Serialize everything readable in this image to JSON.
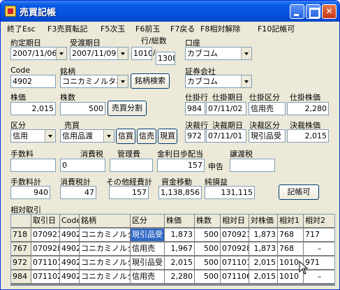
{
  "window": {
    "title": "売買記帳"
  },
  "menu": [
    "終了Esc",
    "F3売買転記",
    "F5次玉",
    "F6前玉",
    "F7戻る",
    "F8相対解除",
    "F10記帳可"
  ],
  "labels": {
    "yakujo_date": "約定期日",
    "ukewatashi_date": "受渡期日",
    "gyo_sosu": "行/総数",
    "koza": "口座",
    "code": "Code",
    "meigara": "銘柄",
    "shoken_gaisha": "証券会社",
    "kabuka": "株価",
    "kabusu": "株数",
    "shikake_gyo": "仕掛行",
    "shikake_kijitsu": "仕掛期日",
    "shikake_kubun": "仕掛区分",
    "shikake_kabuka": "仕掛株価",
    "kubun": "区分",
    "baibai": "売買",
    "kessai_gyo": "決裁行",
    "kessai_kijitsu": "決裁期日",
    "kessai_kubun": "決裁区分",
    "kessai_kabuka": "決裁株価",
    "tesuryo": "手数料",
    "shohizei": "消費税",
    "kanrihi": "管理費",
    "kinri": "金利日歩配当",
    "jotozei": "譲渡税",
    "tesuryo_kei": "手数料計",
    "shohizei_kei": "消費税計",
    "sonota_keihi": "その他経費計",
    "shikin_ido": "資金移動",
    "jun_soneki": "純損益",
    "aitai": "相対取引"
  },
  "fields": {
    "yakujo_date": "2007/11/06",
    "ukewatashi_date": "2007/11/09",
    "gyo": "1010",
    "sosu": "1308",
    "koza": "カブコム",
    "code": "4902",
    "meigara": "コニカミノルタホー",
    "shoken_gaisha": "カブコム",
    "kabuka": "2,015",
    "kabusu": "500",
    "shikake_gyo": "984",
    "shikake_kijitsu": "07/11/02",
    "shikake_kubun": "信用売",
    "shikake_kabuka": "2,280",
    "kubun": "信用",
    "baibai": "信用品渡",
    "kessai_gyo": "972",
    "kessai_kijitsu": "07/11/01",
    "kessai_kubun": "現引品受",
    "kessai_kabuka": "2,015",
    "tesuryo": "",
    "shohizei": "0",
    "kanrihi": "",
    "kinri": "157",
    "jotozei": "",
    "tesuryo_kei": "940",
    "shohizei_kei": "47",
    "sonota_keihi": "157",
    "shikin_ido": "1,138,856",
    "jun_soneki": "131,115"
  },
  "buttons": {
    "slash": "/",
    "meigara_kensaku": "銘柄検索",
    "baibai_bunkatsu": "売買分割",
    "shingai": "信買",
    "shinbai": "信売",
    "genbai": "現買",
    "shinkoku": "申告",
    "kicho_ka": "記帳可"
  },
  "table": {
    "columns": [
      "",
      "取引日",
      "Code",
      "銘柄",
      "区分",
      "株価",
      "株数",
      "相対日",
      "対株価",
      "相対1",
      "相対2"
    ],
    "rows": [
      [
        "718",
        "070921",
        "4902",
        "コニカミノルタ",
        "現引品受",
        "1,873",
        "500",
        "070921",
        "1,873",
        "768",
        "717"
      ],
      [
        "767",
        "070928",
        "4902",
        "コニカミノルタ",
        "信用売",
        "1,967",
        "500",
        "070928",
        "1,873",
        "768",
        "–"
      ],
      [
        "972",
        "071101",
        "4902",
        "コニカミノルタ",
        "現引品受",
        "2,015",
        "500",
        "071101",
        "2,015",
        "1010",
        "971"
      ],
      [
        "984",
        "071102",
        "4902",
        "コニカミノルタ",
        "信用売",
        "2,280",
        "500",
        "071106",
        "2,015",
        "1010",
        "–"
      ]
    ]
  },
  "icons": {
    "app": "ledger-app-icon",
    "cursor": "mouse-pointer-icon"
  },
  "colors": {
    "titlebar": "#0553e0",
    "selection": "#316ac5",
    "close": "#c63716"
  }
}
